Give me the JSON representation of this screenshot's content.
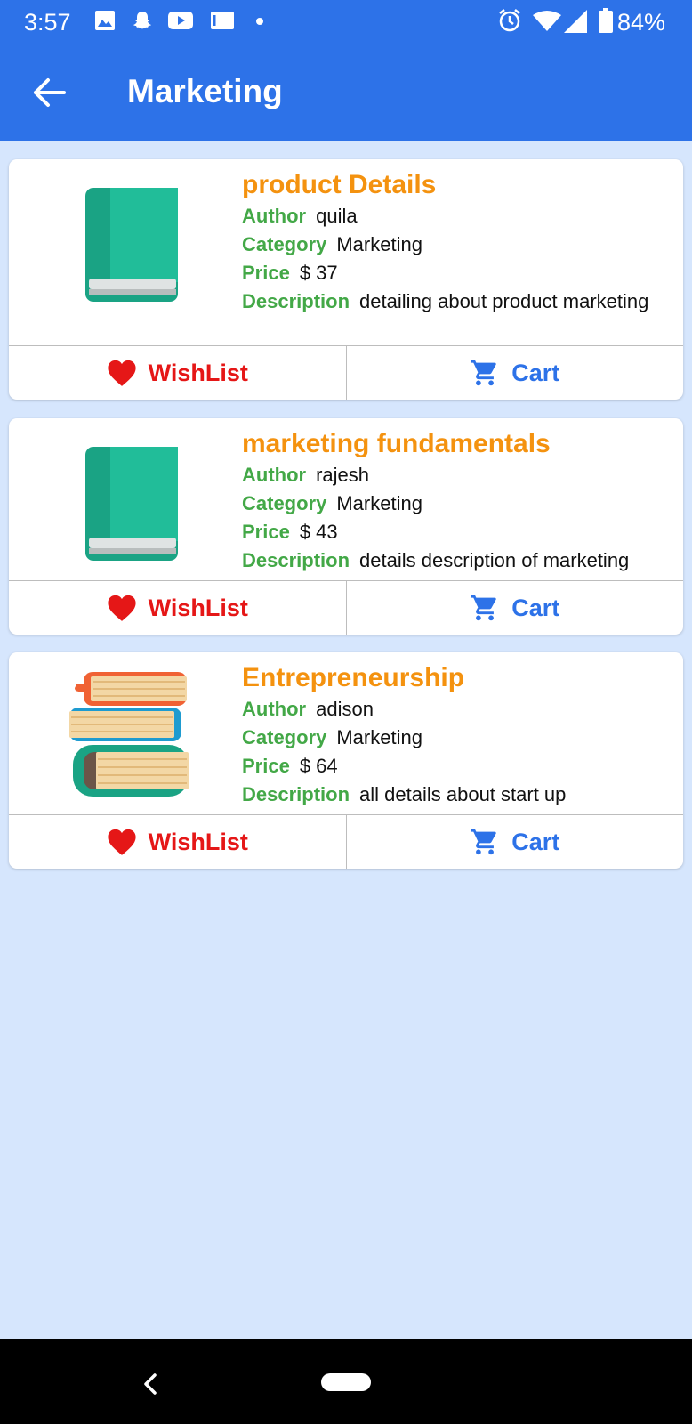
{
  "status_bar": {
    "time": "3:57",
    "battery": "84%",
    "icons": [
      "image-icon",
      "snapchat-icon",
      "youtube-icon",
      "gmail-icon",
      "dot-icon",
      "alarm-icon",
      "wifi-icon",
      "signal-icon",
      "battery-icon"
    ]
  },
  "app_bar": {
    "title": "Marketing",
    "back_icon": "arrow-left-icon"
  },
  "labels": {
    "author": "Author",
    "category": "Category",
    "price": "Price",
    "description": "Description",
    "wishlist": "WishList",
    "cart": "Cart"
  },
  "products": [
    {
      "title": "product Details",
      "author": "quila",
      "category": "Marketing",
      "price": "$ 37",
      "description": "detailing about product marketing",
      "image": "green-book-icon"
    },
    {
      "title": "marketing fundamentals",
      "author": "rajesh",
      "category": "Marketing",
      "price": "$ 43",
      "description": "details description of marketing",
      "image": "green-book-icon"
    },
    {
      "title": "Entrepreneurship",
      "author": "adison",
      "category": "Marketing",
      "price": "$ 64",
      "description": "all details about start up",
      "image": "book-stack-icon"
    }
  ],
  "colors": {
    "primary": "#2d72e8",
    "background": "#d6e6fd",
    "title": "#f4920f",
    "label": "#43a847",
    "wishlist": "#e51717",
    "cart": "#2d72e8"
  },
  "nav_bar": {
    "icons": [
      "nav-back-icon",
      "home-pill-icon"
    ]
  }
}
